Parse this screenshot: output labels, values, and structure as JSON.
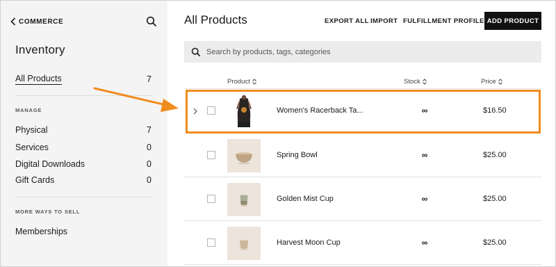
{
  "sidebar": {
    "back_label": "COMMERCE",
    "title": "Inventory",
    "all_products": {
      "label": "All Products",
      "count": "7"
    },
    "manage_heading": "MANAGE",
    "manage_items": [
      {
        "label": "Physical",
        "count": "7"
      },
      {
        "label": "Services",
        "count": "0"
      },
      {
        "label": "Digital Downloads",
        "count": "0"
      },
      {
        "label": "Gift Cards",
        "count": "0"
      }
    ],
    "more_heading": "MORE WAYS TO SELL",
    "more_items": [
      {
        "label": "Memberships"
      }
    ]
  },
  "header": {
    "title": "All Products",
    "export_label": "EXPORT ALL",
    "import_label": "IMPORT",
    "fulfillment_label": "FULFILLMENT PROFILES",
    "add_label": "ADD PRODUCT"
  },
  "search": {
    "placeholder": "Search by products, tags, categories"
  },
  "table": {
    "columns": {
      "product": "Product",
      "stock": "Stock",
      "price": "Price"
    },
    "rows": [
      {
        "name": "Women's Racerback Ta...",
        "stock": "∞",
        "price": "$16.50",
        "thumb": "tank-top"
      },
      {
        "name": "Spring Bowl",
        "stock": "∞",
        "price": "$25.00",
        "thumb": "bowl"
      },
      {
        "name": "Golden Mist Cup",
        "stock": "∞",
        "price": "$25.00",
        "thumb": "cup"
      },
      {
        "name": "Harvest Moon Cup",
        "stock": "∞",
        "price": "$25.00",
        "thumb": "cup"
      }
    ]
  },
  "colors": {
    "accent_highlight": "#f08c1e",
    "sidebar_bg": "#f4f4f4",
    "button_bg": "#111111",
    "thumb_bg": "#ede4dc"
  }
}
